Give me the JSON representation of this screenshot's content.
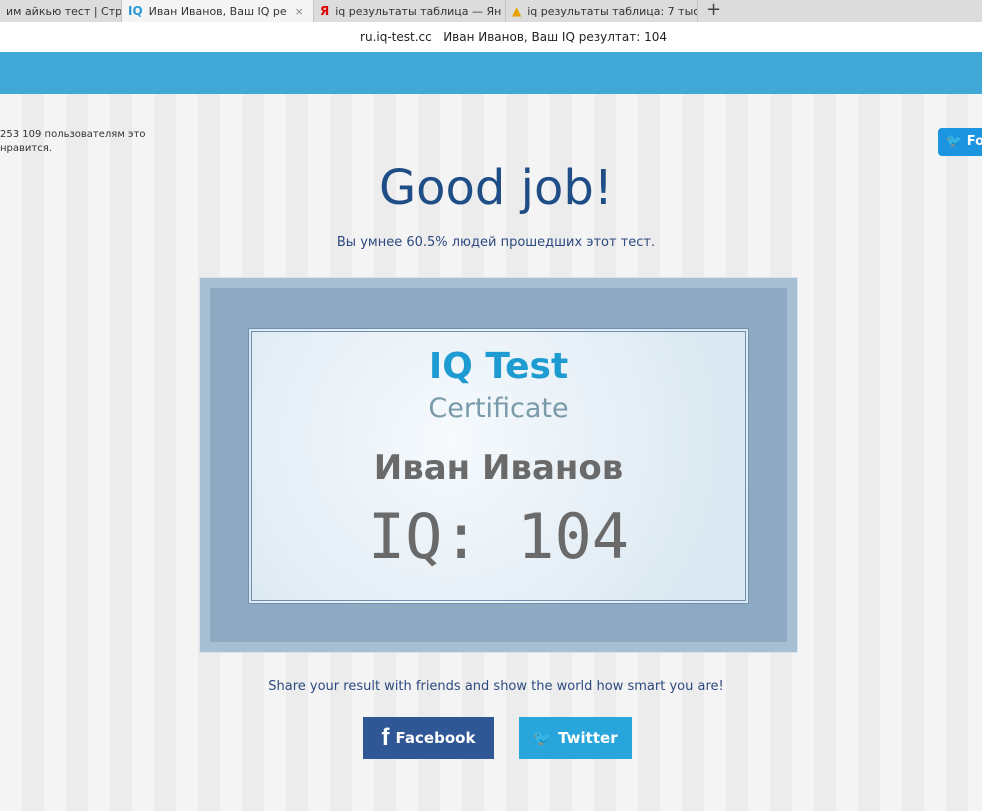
{
  "browser": {
    "tabs": [
      {
        "label": "им айкью тест | Стра",
        "icon": ""
      },
      {
        "label": "Иван Иванов, Ваш IQ ре",
        "icon": "IQ",
        "active": true
      },
      {
        "label": "iq результаты таблица — Ян",
        "icon": "Я"
      },
      {
        "label": "iq результаты таблица: 7 тыс",
        "icon": "image-icon"
      }
    ],
    "close": "×",
    "new_tab": "+",
    "address_domain": "ru.iq-test.cc",
    "address_title": "Иван Иванов, Ваш IQ резултат: 104"
  },
  "sidebar": {
    "likes_text": "253 109 пользователям это нравится.",
    "follow_label": "Fo"
  },
  "main": {
    "heading": "Good job!",
    "subheading": "Вы умнее 60.5% людей прошедших этот тест.",
    "certificate": {
      "title": "IQ Test",
      "subtitle": "Certificate",
      "name": "Иван Иванов",
      "score": "IQ: 104"
    },
    "share_text": "Share your result with friends and show the world how smart you are!",
    "facebook_label": "Facebook",
    "twitter_label": "Twitter"
  }
}
